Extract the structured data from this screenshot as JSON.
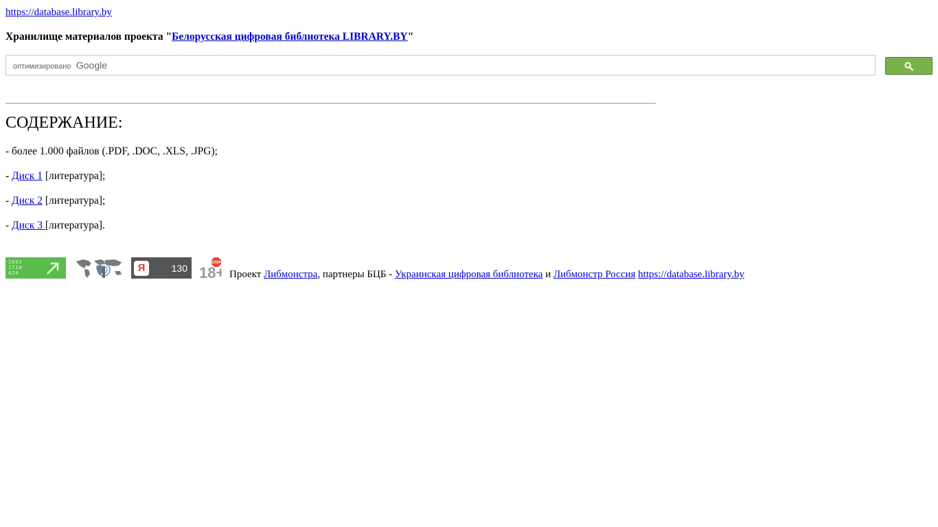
{
  "header": {
    "top_link": "https://database.library.by",
    "repo_prefix": "Хранилище материалов проекта \"",
    "repo_link": "Белорусская цифровая библиотека LIBRARY.BY",
    "repo_suffix": "\""
  },
  "search": {
    "placeholder_prefix": "оптимизировано",
    "placeholder_brand": "Google",
    "button_icon": "search-icon",
    "button_color": "#79b24a"
  },
  "contents": {
    "title": "СОДЕРЖАНИЕ:",
    "line1": "- более 1.000 файлов (.PDF, .DOC, .XLS, .JPG);",
    "items": [
      {
        "prefix": "- ",
        "link": "Диск 1",
        "suffix": " [литература];"
      },
      {
        "prefix": "- ",
        "link": "Диск 2",
        "suffix": " [литература];"
      },
      {
        "prefix": "- ",
        "link": "Диск 3 ",
        "suffix": "[литература]."
      }
    ]
  },
  "footer": {
    "counter1_lines": [
      "2692",
      "1716",
      "424"
    ],
    "counter1_color": "#5bbb4c",
    "world_icon": "world-map-icon",
    "yandex_logo": "Я",
    "yandex_count": "130",
    "age_badge_text": "18+",
    "age_badge_stop": "STOP",
    "text_project": "Проект ",
    "link_libmonster": "Либмонстра",
    "text_partners": ", партнеры БЦБ - ",
    "link_ukr": "Украинская цифровая библиотека",
    "text_and": " и ",
    "link_russia": "Либмонстр Россия",
    "link_site": "https://database.library.by"
  }
}
